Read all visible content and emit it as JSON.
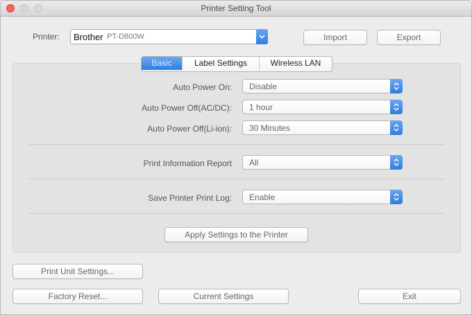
{
  "window": {
    "title": "Printer Setting Tool"
  },
  "printer": {
    "label": "Printer:",
    "brand": "Brother",
    "model": "PT-D800W"
  },
  "actions": {
    "import": "Import",
    "export": "Export"
  },
  "tabs": [
    {
      "label": "Basic",
      "active": true
    },
    {
      "label": "Label Settings",
      "active": false
    },
    {
      "label": "Wireless LAN",
      "active": false
    }
  ],
  "settings": {
    "auto_power_on": {
      "label": "Auto Power On:",
      "value": "Disable"
    },
    "auto_power_off_ac": {
      "label": "Auto Power Off(AC/DC):",
      "value": "1 hour"
    },
    "auto_power_off_li": {
      "label": "Auto Power Off(Li-ion):",
      "value": "30 Minutes"
    },
    "print_info_report": {
      "label": "Print Information Report",
      "value": "All"
    },
    "save_print_log": {
      "label": "Save Printer Print Log:",
      "value": "Enable"
    }
  },
  "buttons": {
    "apply": "Apply Settings to the Printer",
    "print_unit": "Print Unit Settings...",
    "factory_reset": "Factory Reset...",
    "current_settings": "Current Settings",
    "exit": "Exit"
  },
  "colors": {
    "accent": "#2f7ce0",
    "background": "#ececec",
    "panel": "#e3e3e3"
  }
}
